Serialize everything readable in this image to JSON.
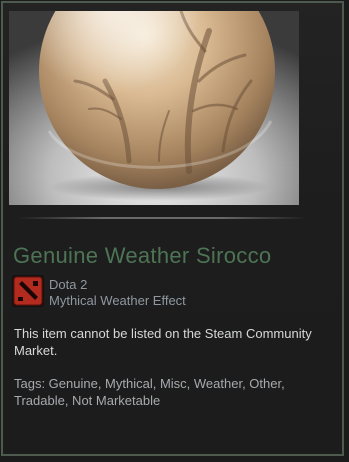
{
  "item": {
    "name": "Genuine Weather Sirocco",
    "name_color": "#4d7455",
    "game": "Dota 2",
    "type": "Mythical Weather Effect",
    "description": "This item cannot be listed on the Steam Community Market.",
    "tags": "Tags: Genuine, Mythical, Misc, Weather, Other, Tradable, Not Marketable",
    "image_icon": "sand-orb-image",
    "game_icon": "dota2-logo-icon"
  },
  "colors": {
    "card_border": "#4f5a4f",
    "secondary_text": "#8f98a0",
    "body_text": "#d6d7d8"
  }
}
